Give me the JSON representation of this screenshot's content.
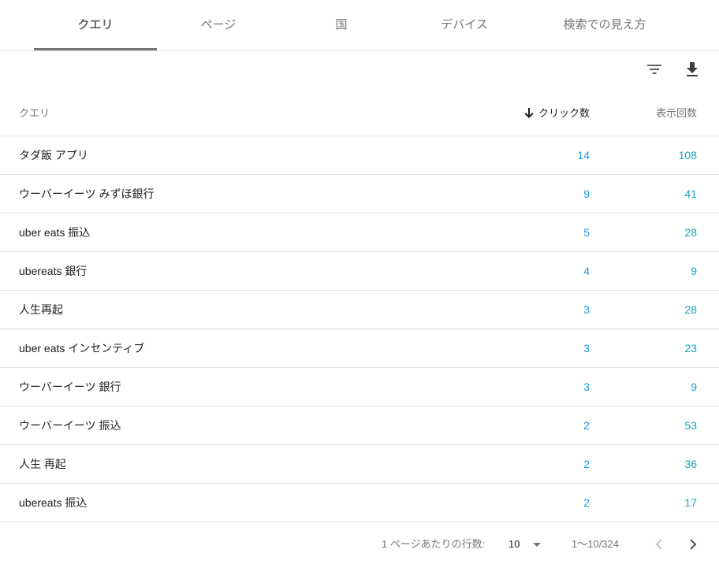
{
  "tabs": [
    {
      "label": "クエリ",
      "active": true
    },
    {
      "label": "ページ",
      "active": false
    },
    {
      "label": "国",
      "active": false
    },
    {
      "label": "デバイス",
      "active": false
    },
    {
      "label": "検索での見え方",
      "active": false
    }
  ],
  "toolbar": {
    "filter_icon": "filter-list-icon",
    "download_icon": "download-icon"
  },
  "table": {
    "headers": {
      "query": "クエリ",
      "clicks": "クリック数",
      "impressions": "表示回数"
    },
    "sort_icon": "arrow-downward-icon",
    "rows": [
      {
        "query": "タダ飯 アプリ",
        "clicks": "14",
        "impressions": "108"
      },
      {
        "query": "ウーバーイーツ みずほ銀行",
        "clicks": "9",
        "impressions": "41"
      },
      {
        "query": "uber eats 振込",
        "clicks": "5",
        "impressions": "28"
      },
      {
        "query": "ubereats 銀行",
        "clicks": "4",
        "impressions": "9"
      },
      {
        "query": "人生再起",
        "clicks": "3",
        "impressions": "28"
      },
      {
        "query": "uber eats インセンティブ",
        "clicks": "3",
        "impressions": "23"
      },
      {
        "query": "ウーバーイーツ 銀行",
        "clicks": "3",
        "impressions": "9"
      },
      {
        "query": "ウーバーイーツ 振込",
        "clicks": "2",
        "impressions": "53"
      },
      {
        "query": "人生 再起",
        "clicks": "2",
        "impressions": "36"
      },
      {
        "query": "ubereats 振込",
        "clicks": "2",
        "impressions": "17"
      }
    ]
  },
  "pagination": {
    "rows_per_page_label": "1 ページあたりの行数:",
    "rows_per_page_value": "10",
    "range": "1〜10/324"
  },
  "colors": {
    "clicks": "#1a9be6",
    "impressions": "#12a4c4",
    "tab_indicator": "#757575"
  }
}
